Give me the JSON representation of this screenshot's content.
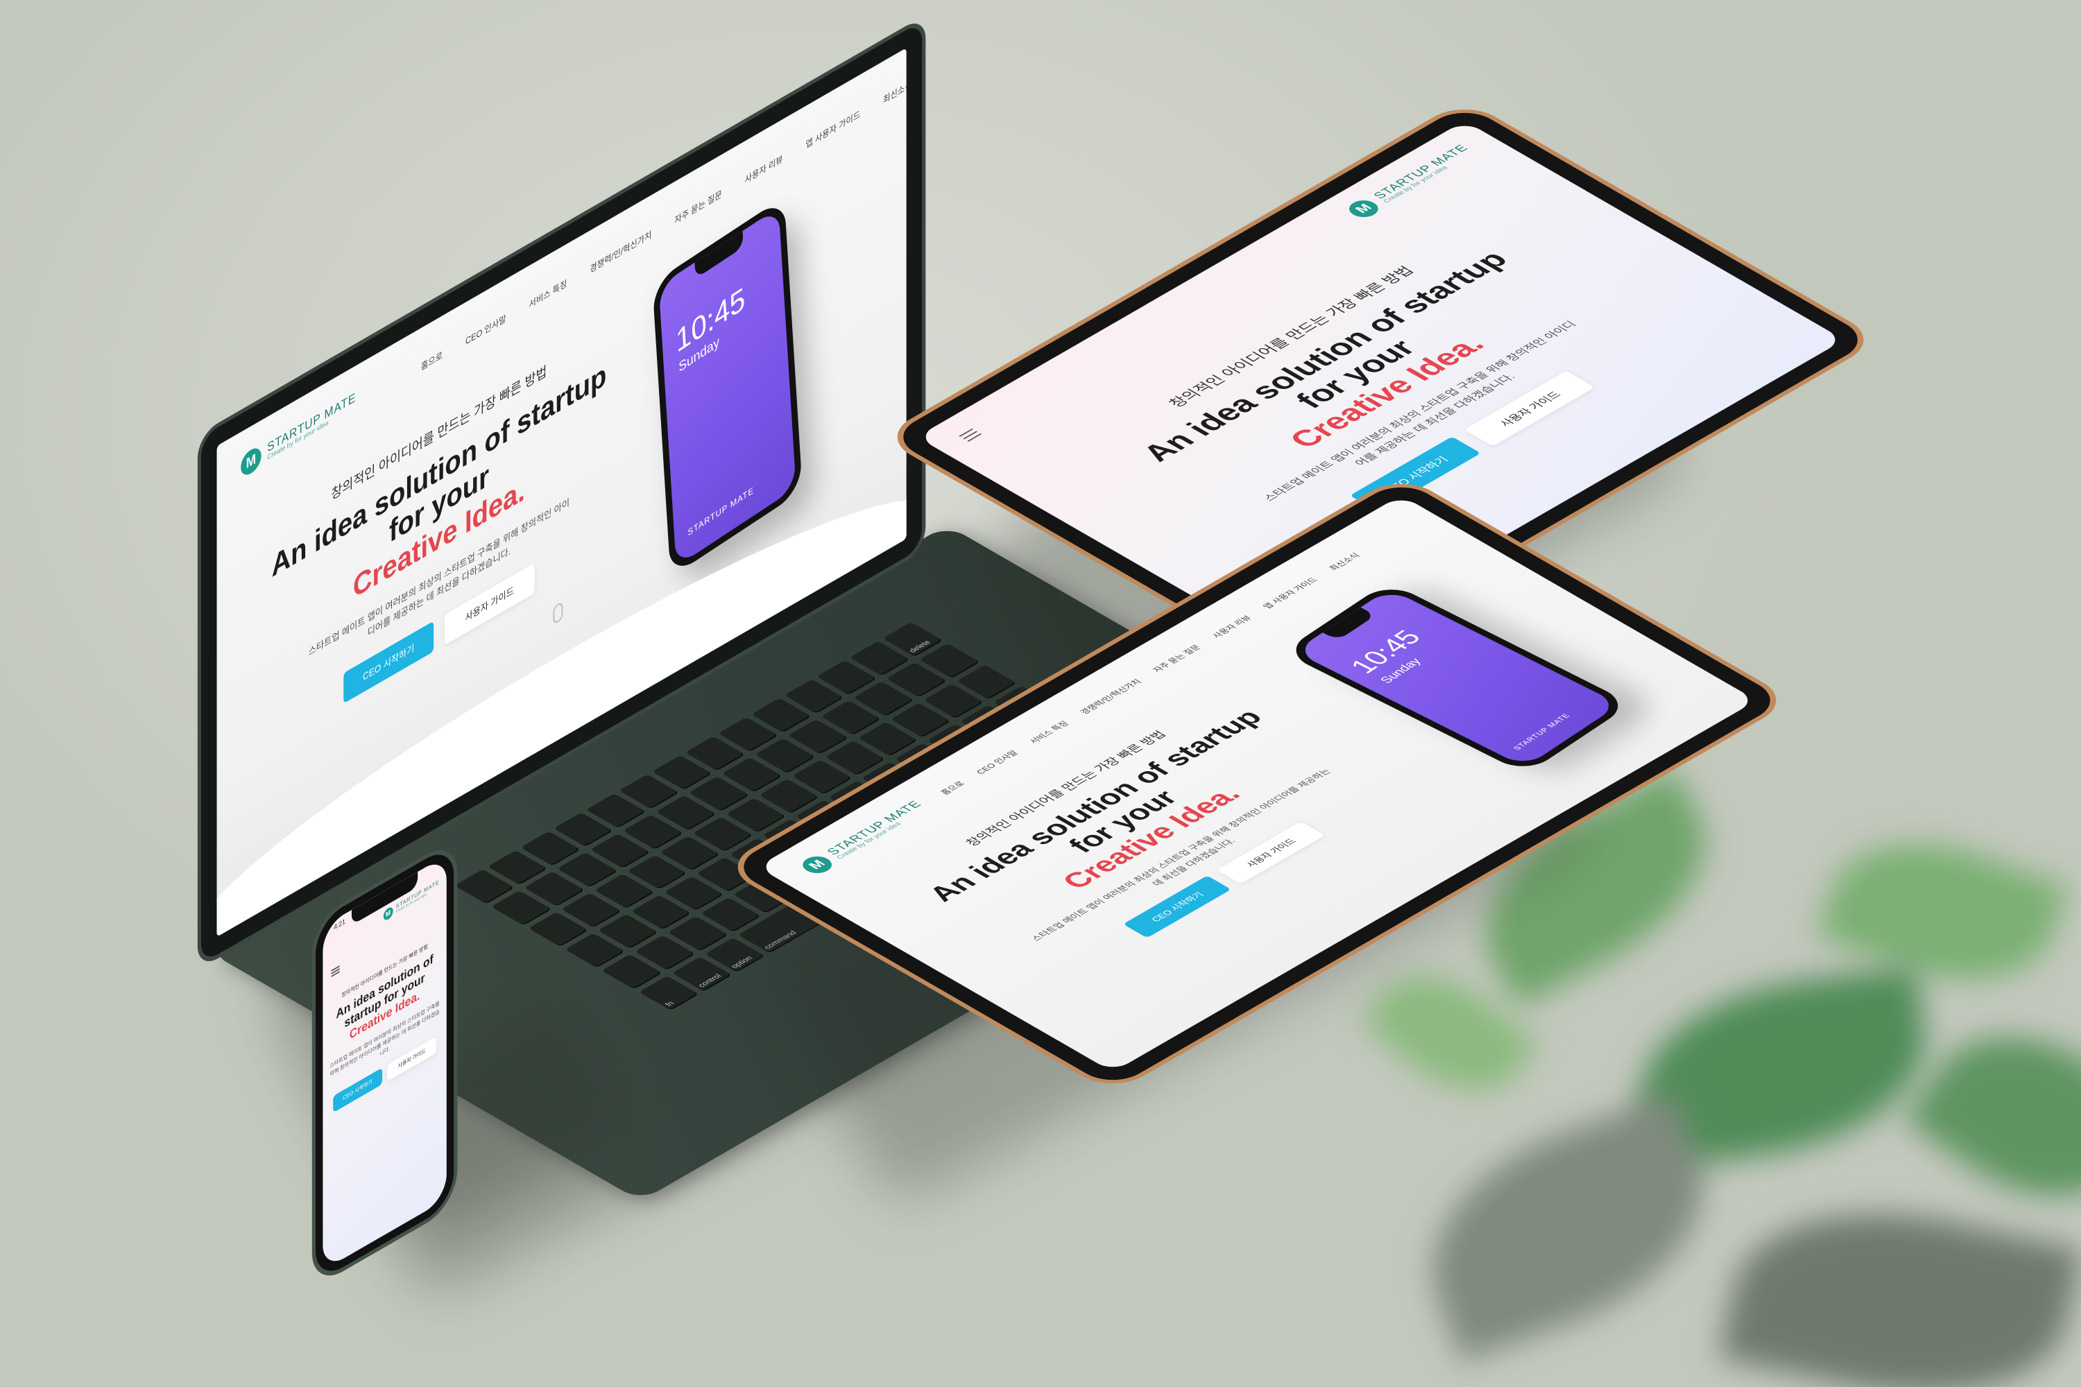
{
  "site": {
    "brand_name": "STARTUP MATE",
    "brand_tagline": "Create by for your idea",
    "nav": [
      "홈으로",
      "CEO 인사말",
      "서비스 특징",
      "경쟁력/인/혁신가치",
      "자주 묻는 질문",
      "사용자 리뷰",
      "앱 사용자 가이드",
      "최신소식"
    ],
    "hero_subtitle": "창의적인 아이디어를 만드는 가장 빠른 방법",
    "hero_title_line1": "An idea solution of startup",
    "hero_title_line2": "for your",
    "hero_title_mobile_line1": "An idea solution of",
    "hero_title_mobile_line2": "startup for your",
    "hero_accent": "Creative Idea.",
    "hero_description": "스타트업 메이트 앱이 여러분의 최상의 스타트업 구축을 위해 창의적인 아이디어를 제공하는 데 최선을 다하겠습니다.",
    "cta_primary": "CEO 시작하기",
    "cta_secondary": "사용자 가이드"
  },
  "phone_mock": {
    "time": "10:45",
    "day": "Sunday",
    "status_time": "4:21"
  },
  "keyboard": {
    "keys": [
      "delete",
      "fn",
      "control",
      "option",
      "command",
      "command",
      "option"
    ]
  },
  "colors": {
    "accent_red": "#e5464f",
    "primary_blue": "#1fb4e2",
    "brand_teal": "#1e9c8d",
    "phone_purple": "#7b55e8"
  }
}
